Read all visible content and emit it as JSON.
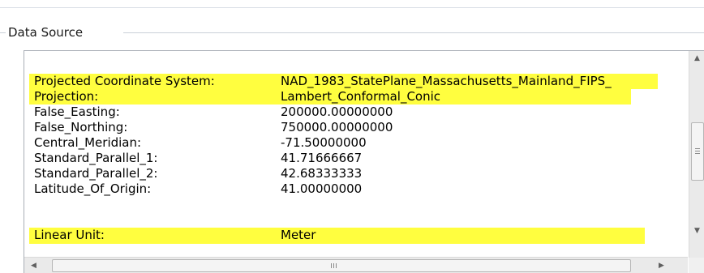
{
  "group": {
    "title": "Data Source"
  },
  "properties": [
    {
      "key": "Projected Coordinate System:",
      "value": "NAD_1983_StatePlane_Massachusetts_Mainland_FIPS_",
      "highlighted": true
    },
    {
      "key": "Projection:",
      "value": "Lambert_Conformal_Conic",
      "highlighted": true
    },
    {
      "key": "False_Easting:",
      "value": "200000.00000000",
      "highlighted": false
    },
    {
      "key": "False_Northing:",
      "value": "750000.00000000",
      "highlighted": false
    },
    {
      "key": "Central_Meridian:",
      "value": "-71.50000000",
      "highlighted": false
    },
    {
      "key": "Standard_Parallel_1:",
      "value": "41.71666667",
      "highlighted": false
    },
    {
      "key": "Standard_Parallel_2:",
      "value": "42.68333333",
      "highlighted": false
    },
    {
      "key": "Latitude_Of_Origin:",
      "value": "41.00000000",
      "highlighted": false
    },
    {
      "key": "Linear Unit:",
      "value": "Meter",
      "highlighted": true
    }
  ],
  "highlight_color": "#fffe3f",
  "icons": {
    "scroll_up": "▲",
    "scroll_down": "▼",
    "scroll_left": "◀",
    "scroll_right": "▶"
  }
}
